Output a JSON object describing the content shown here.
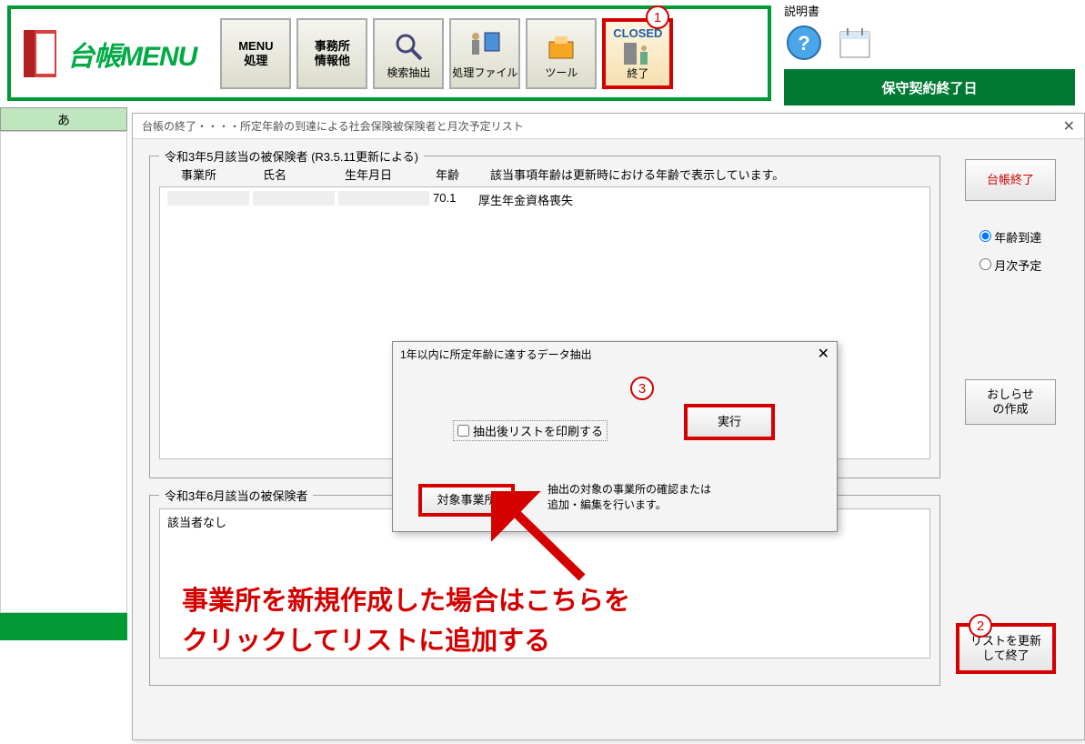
{
  "toolbar": {
    "title": "台帳MENU",
    "buttons": {
      "menu_proc": "MENU\n処理",
      "office_info": "事務所\n情報他",
      "search": "検索抽出",
      "proc_file": "処理ファイル",
      "tool": "ツール",
      "close_top": "CLOSED",
      "close_bot": "終了"
    }
  },
  "topright": {
    "label": "説明書"
  },
  "green_bar": "保守契約終了日",
  "left": {
    "header": "あ"
  },
  "dialog": {
    "title": "台帳の終了・・・・所定年齢の到達による社会保険被保険者と月次予定リスト",
    "fs1_legend": "令和3年5月該当の被保険者 (R3.5.11更新による)",
    "col_office": "事業所",
    "col_name": "氏名",
    "col_dob": "生年月日",
    "col_age": "年齢",
    "col_note": "該当事項年齢は更新時における年齢で表示しています。",
    "row1_age": "70.1",
    "row1_desc": "厚生年金資格喪失",
    "fs2_legend": "令和3年6月該当の被保険者",
    "fs2_row": "該当者なし",
    "btn_close": "台帳終了",
    "radio1": "年齢到達",
    "radio2": "月次予定",
    "btn_notice": "おしらせ\nの作成",
    "btn_update": "リストを更新\nして終了"
  },
  "inner": {
    "title": "1年以内に所定年齢に達するデータ抽出",
    "checkbox": "抽出後リストを印刷する",
    "exec": "実行",
    "target": "対象事業所",
    "desc1": "抽出の対象の事業所の確認または",
    "desc2": "追加・編集を行います。"
  },
  "annot": {
    "c1": "1",
    "c2": "2",
    "c3": "3",
    "big1": "事業所を新規作成した場合はこちらを",
    "big2": "クリックしてリストに追加する"
  }
}
